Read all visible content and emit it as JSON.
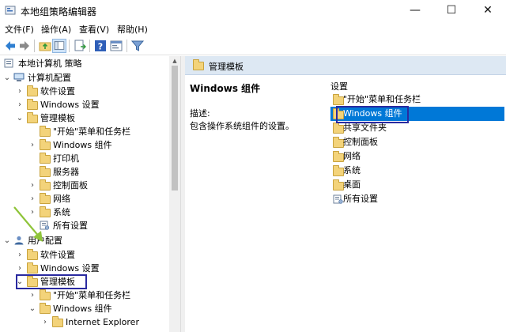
{
  "window": {
    "title": "本地组策略编辑器",
    "controls": {
      "minimize": "—",
      "maximize": "☐",
      "close": "✕"
    }
  },
  "menu": {
    "file": "文件(F)",
    "action": "操作(A)",
    "view": "查看(V)",
    "help": "帮助(H)"
  },
  "toolbar": {
    "icons": [
      "back-icon",
      "forward-icon",
      "up-folder-icon",
      "show-hide-tree-icon",
      "export-list-icon",
      "help-icon",
      "properties-icon",
      "filter-icon"
    ]
  },
  "tree": {
    "root": "本地计算机 策略",
    "computer_config": "计算机配置",
    "cc_software": "软件设置",
    "cc_windows": "Windows 设置",
    "cc_admin": "管理模板",
    "cc_admin_start": "\"开始\"菜单和任务栏",
    "cc_admin_wincomp": "Windows 组件",
    "cc_admin_printer": "打印机",
    "cc_admin_server": "服务器",
    "cc_admin_control": "控制面板",
    "cc_admin_network": "网络",
    "cc_admin_system": "系统",
    "cc_admin_all": "所有设置",
    "user_config": "用户配置",
    "uc_software": "软件设置",
    "uc_windows": "Windows 设置",
    "uc_admin": "管理模板",
    "uc_admin_start": "\"开始\"菜单和任务栏",
    "uc_admin_wincomp": "Windows 组件",
    "uc_admin_ie": "Internet Explorer"
  },
  "right": {
    "header": "管理模板",
    "detail_title": "Windows 组件",
    "desc_label": "描述:",
    "desc_text": "包含操作系统组件的设置。",
    "list_head": "设置",
    "items": [
      "\"开始\"菜单和任务栏",
      "Windows 组件",
      "共享文件夹",
      "控制面板",
      "网络",
      "系统",
      "桌面",
      "所有设置"
    ]
  },
  "colors": {
    "selection": "#0078d7",
    "header_bg": "#dde8f3",
    "highlight_box": "#2a2aa0",
    "arrow": "#8fc43a",
    "folder": "#f3d37a"
  }
}
